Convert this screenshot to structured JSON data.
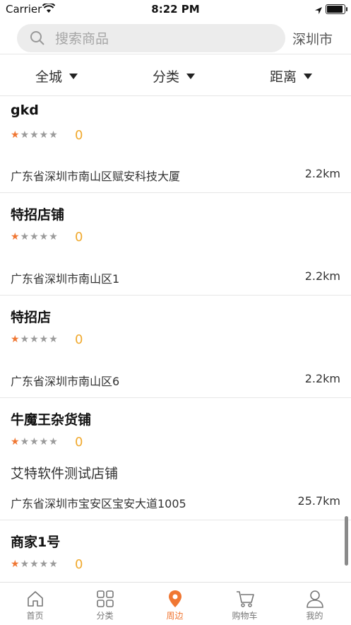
{
  "status": {
    "carrier": "Carrier",
    "time": "8:22 PM"
  },
  "search": {
    "placeholder": "搜索商品",
    "city": "深圳市"
  },
  "filters": [
    "全城",
    "分类",
    "距离"
  ],
  "stores": [
    {
      "name": "gkd",
      "rating": 1,
      "score": "0",
      "desc": "",
      "address": "广东省深圳市南山区赋安科技大厦",
      "distance": "2.2km"
    },
    {
      "name": "特招店铺",
      "rating": 1,
      "score": "0",
      "desc": "",
      "address": "广东省深圳市南山区1",
      "distance": "2.2km"
    },
    {
      "name": "特招店",
      "rating": 1,
      "score": "0",
      "desc": "",
      "address": "广东省深圳市南山区6",
      "distance": "2.2km"
    },
    {
      "name": "牛魔王杂货铺",
      "rating": 1,
      "score": "0",
      "desc": "艾特软件测试店铺",
      "address": "广东省深圳市宝安区宝安大道1005",
      "distance": "25.7km"
    },
    {
      "name": "商家1号",
      "rating": 1,
      "score": "0",
      "desc": "",
      "address": "",
      "distance": ""
    }
  ],
  "tabs": [
    {
      "label": "首页",
      "icon": "home-icon"
    },
    {
      "label": "分类",
      "icon": "category-icon"
    },
    {
      "label": "周边",
      "icon": "location-pin-icon",
      "active": true
    },
    {
      "label": "购物车",
      "icon": "cart-icon"
    },
    {
      "label": "我的",
      "icon": "user-icon"
    }
  ],
  "colors": {
    "accent": "#f07733",
    "score": "#f0a92e"
  }
}
